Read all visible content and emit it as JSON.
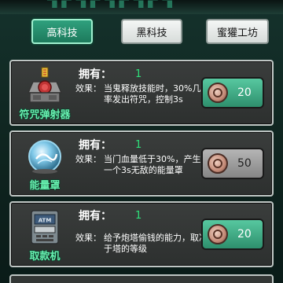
{
  "tabs": [
    {
      "label": "高科技",
      "active": true
    },
    {
      "label": "黑科技",
      "active": false
    },
    {
      "label": "蜜獾工坊",
      "active": false
    }
  ],
  "items": [
    {
      "name": "符咒弹射器",
      "icon": "talisman-launcher-icon",
      "own_label": "拥有：",
      "own_value": "1",
      "effect_label": "效果：",
      "effect_text": "当鬼释放技能时，30%几率发出符咒，控制3s",
      "price": "20",
      "button_style": "green"
    },
    {
      "name": "能量罩",
      "icon": "energy-shield-icon",
      "own_label": "拥有：",
      "own_value": "1",
      "effect_label": "效果：",
      "effect_text": "当门血量低于30%，产生一个3s无敌的能量罩",
      "price": "50",
      "button_style": "grey"
    },
    {
      "name": "取款机",
      "icon": "atm-icon",
      "atm_label": "ATM",
      "own_label": "拥有：",
      "own_value": "1",
      "effect_label": "效果：",
      "effect_text": "给予炮塔偷钱的能力，取决于塔的等级",
      "price": "20",
      "button_style": "green"
    }
  ],
  "colors": {
    "accent_green": "#2fa07d",
    "item_name": "#67f0b0",
    "own_value": "#2ee07a",
    "bg": "#15322c"
  }
}
